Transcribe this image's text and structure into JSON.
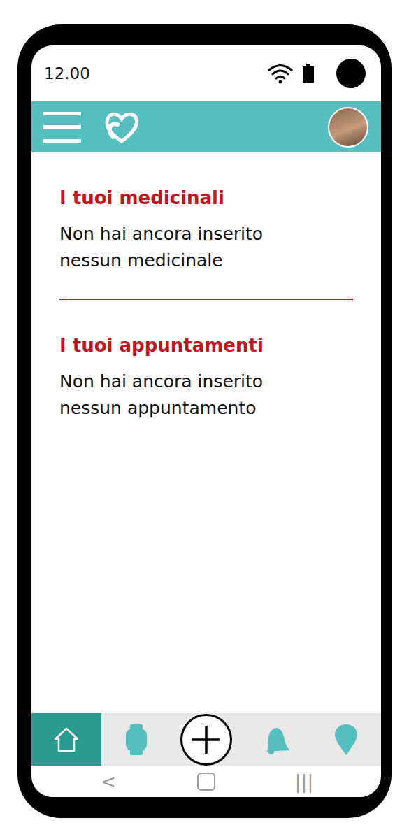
{
  "status_bar": {
    "time": "12.00"
  },
  "sections": [
    {
      "title": "I tuoi medicinali",
      "empty_text": "Non hai ancora inserito nessun medicinale"
    },
    {
      "title": "I tuoi appuntamenti",
      "empty_text": "Non hai ancora inserito nessun appuntamento"
    }
  ],
  "bottom_nav": [
    {
      "kind": "home",
      "selected": true
    },
    {
      "kind": "watch",
      "selected": false
    },
    {
      "kind": "add",
      "selected": false
    },
    {
      "kind": "bell",
      "selected": false
    },
    {
      "kind": "location",
      "selected": false
    }
  ],
  "system_nav": [
    {
      "kind": "back",
      "label": "<"
    },
    {
      "kind": "home",
      "label": ""
    },
    {
      "kind": "recents",
      "label": "|||"
    }
  ]
}
